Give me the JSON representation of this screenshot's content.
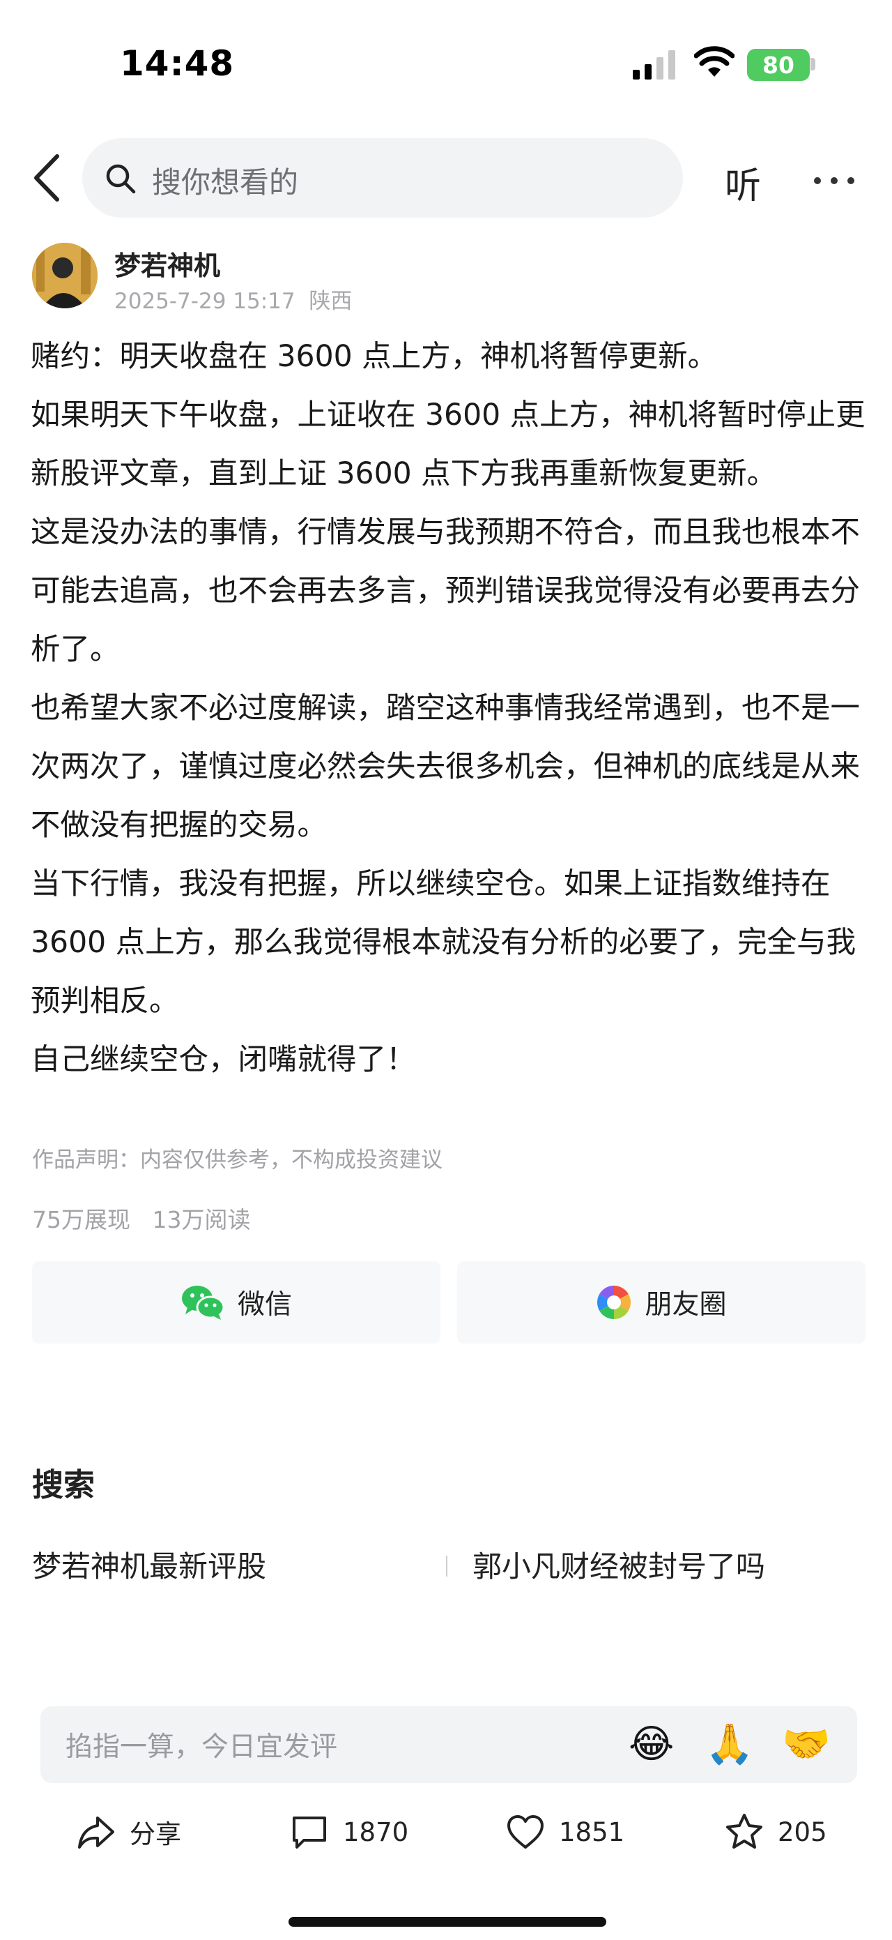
{
  "status_bar": {
    "time": "14:48",
    "battery": "80"
  },
  "nav": {
    "search_placeholder": "搜你想看的",
    "listen_label": "听"
  },
  "post": {
    "author": "梦若神机",
    "date": "2025-7-29 15:17",
    "location": "陕西",
    "paragraphs": [
      "赌约：明天收盘在 3600 点上方，神机将暂停更新。",
      "如果明天下午收盘，上证收在 3600 点上方，神机将暂时停止更新股评文章，直到上证 3600 点下方我再重新恢复更新。",
      "这是没办法的事情，行情发展与我预期不符合，而且我也根本不可能去追高，也不会再去多言，预判错误我觉得没有必要再去分析了。",
      "也希望大家不必过度解读，踏空这种事情我经常遇到，也不是一次两次了，谨慎过度必然会失去很多机会，但神机的底线是从来不做没有把握的交易。",
      "当下行情，我没有把握，所以继续空仓。如果上证指数维持在 3600 点上方，那么我觉得根本就没有分析的必要了，完全与我预判相反。",
      "自己继续空仓，闭嘴就得了！"
    ],
    "disclaimer": "作品声明：内容仅供参考，不构成投资建议",
    "impressions": "75万展现",
    "reads": "13万阅读"
  },
  "share": {
    "wechat": "微信",
    "moments": "朋友圈"
  },
  "search_section": {
    "title": "搜索",
    "items": [
      "梦若神机最新评股",
      "郭小凡财经被封号了吗"
    ]
  },
  "comment_bar": {
    "placeholder": "掐指一算，今日宜发评",
    "emojis": [
      "😂",
      "🙏",
      "🤝"
    ]
  },
  "actions": {
    "share": "分享",
    "comments": "1870",
    "likes": "1851",
    "favorites": "205"
  },
  "colors": {
    "battery": "#4fcb60",
    "wechat": "#2fc25b",
    "text_secondary": "#a2a2a7"
  }
}
